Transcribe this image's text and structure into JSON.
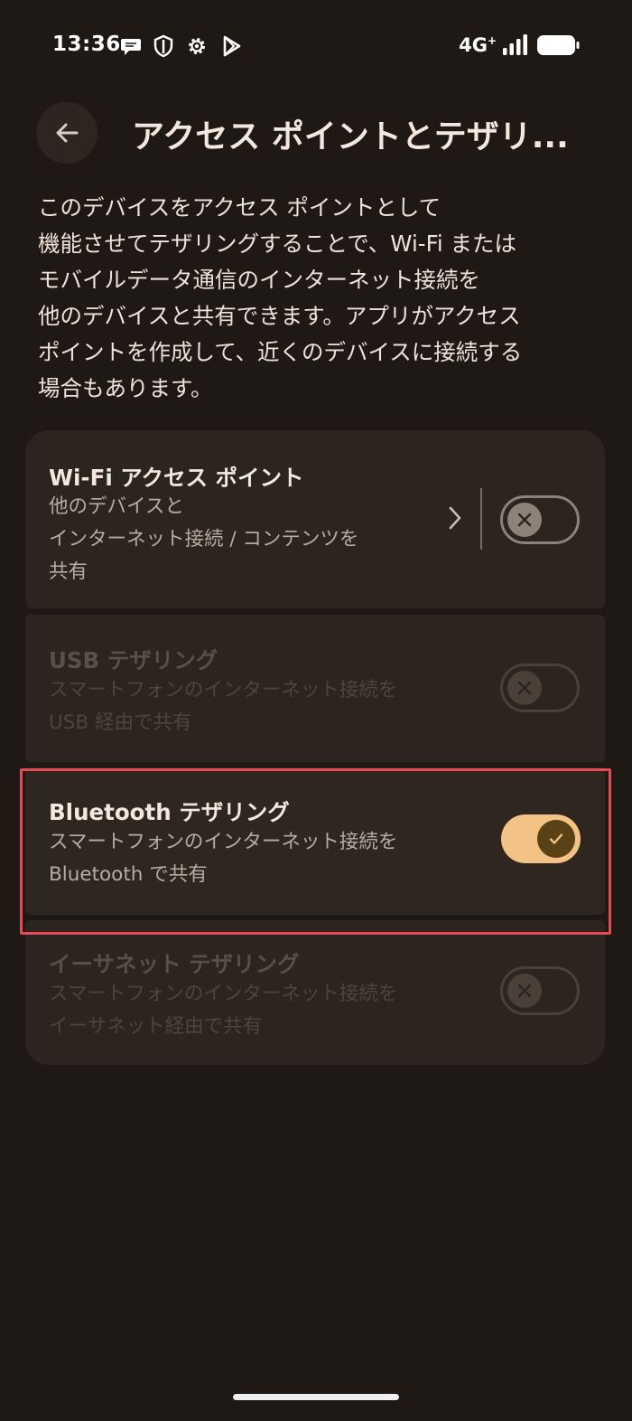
{
  "status_bar": {
    "time": "13:36",
    "network": "4G",
    "network_sup": "+",
    "icons": [
      "chat-bubble-icon",
      "shield-icon",
      "gear-icon",
      "play-store-icon",
      "signal-icon",
      "battery-icon"
    ]
  },
  "header": {
    "back_icon": "arrow-left-icon",
    "title": "アクセス ポイントとテザリ..."
  },
  "description": {
    "lines": [
      "このデバイスをアクセス ポイントとして",
      "機能させてテザリングすることで、Wi-Fi または",
      "モバイルデータ通信のインターネット接続を",
      "他のデバイスと共有できます。アプリがアクセス",
      "ポイントを作成して、近くのデバイスに接続する",
      "場合もあります。"
    ]
  },
  "items": {
    "wifi": {
      "title": "Wi-Fi アクセス ポイント",
      "sub1": "他のデバイスと",
      "sub2": "インターネット接続 / コンテンツを",
      "sub3": "共有",
      "state": "off"
    },
    "usb": {
      "title": "USB テザリング",
      "sub1": "スマートフォンのインターネット接続を",
      "sub2": "USB 経由で共有",
      "state": "off",
      "enabled": false
    },
    "bluetooth": {
      "title": "Bluetooth テザリング",
      "sub1": "スマートフォンのインターネット接続を",
      "sub2": "Bluetooth で共有",
      "state": "on"
    },
    "ethernet": {
      "title": "イーサネット テザリング",
      "sub1": "スマートフォンのインターネット接続を",
      "sub2": "イーサネット経由で共有",
      "state": "off",
      "enabled": false
    }
  },
  "colors": {
    "background": "#1f1915",
    "card": "#2c241e",
    "switch_on": "#f2c384",
    "highlight": "#e64a57"
  }
}
